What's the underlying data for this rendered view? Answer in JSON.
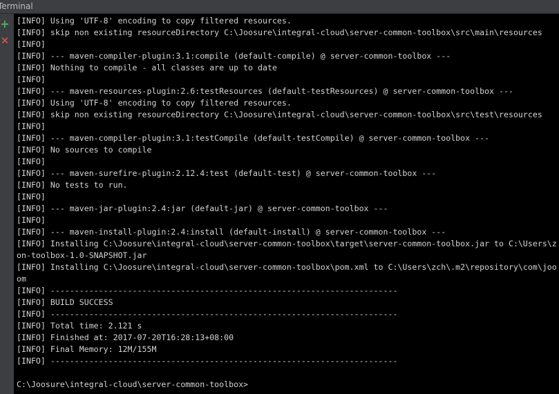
{
  "window": {
    "title": "Terminal"
  },
  "sidebar": {
    "add_icon": "+",
    "close_icon": "✕"
  },
  "terminal": {
    "lines": [
      "[INFO] Using 'UTF-8' encoding to copy filtered resources.",
      "[INFO] skip non existing resourceDirectory C:\\Joosure\\integral-cloud\\server-common-toolbox\\src\\main\\resources",
      "[INFO]",
      "[INFO] --- maven-compiler-plugin:3.1:compile (default-compile) @ server-common-toolbox ---",
      "[INFO] Nothing to compile - all classes are up to date",
      "[INFO]",
      "[INFO] --- maven-resources-plugin:2.6:testResources (default-testResources) @ server-common-toolbox ---",
      "[INFO] Using 'UTF-8' encoding to copy filtered resources.",
      "[INFO] skip non existing resourceDirectory C:\\Joosure\\integral-cloud\\server-common-toolbox\\src\\test\\resources",
      "[INFO]",
      "[INFO] --- maven-compiler-plugin:3.1:testCompile (default-testCompile) @ server-common-toolbox ---",
      "[INFO] No sources to compile",
      "[INFO]",
      "[INFO] --- maven-surefire-plugin:2.12.4:test (default-test) @ server-common-toolbox ---",
      "[INFO] No tests to run.",
      "[INFO]",
      "[INFO] --- maven-jar-plugin:2.4:jar (default-jar) @ server-common-toolbox ---",
      "[INFO]",
      "[INFO] --- maven-install-plugin:2.4:install (default-install) @ server-common-toolbox ---",
      "[INFO] Installing C:\\Joosure\\integral-cloud\\server-common-toolbox\\target\\server-common-toolbox.jar to C:\\Users\\z",
      "on-toolbox-1.0-SNAPSHOT.jar",
      "[INFO] Installing C:\\Joosure\\integral-cloud\\server-common-toolbox\\pom.xml to C:\\Users\\zch\\.m2\\repository\\com\\joo",
      "om",
      "[INFO] ------------------------------------------------------------------------",
      "[INFO] BUILD SUCCESS",
      "[INFO] ------------------------------------------------------------------------",
      "[INFO] Total time: 2.121 s",
      "[INFO] Finished at: 2017-07-20T16:28:13+08:00",
      "[INFO] Final Memory: 12M/155M",
      "[INFO] ------------------------------------------------------------------------",
      "",
      "C:\\Joosure\\integral-cloud\\server-common-toolbox>"
    ]
  }
}
